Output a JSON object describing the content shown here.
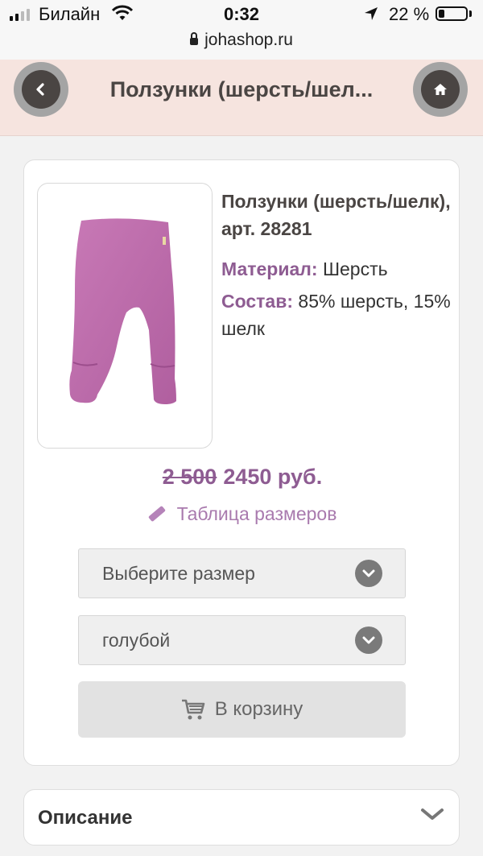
{
  "status_bar": {
    "carrier": "Билайн",
    "time": "0:32",
    "battery": "22 %",
    "battery_level": 0.22,
    "url": "johashop.ru"
  },
  "header": {
    "title": "Ползунки (шерсть/шел...",
    "back_icon": "chevron-left-icon",
    "home_icon": "home-icon"
  },
  "product": {
    "name": "Ползунки (шерсть/шелк), арт. 28281",
    "material_label": "Материал:",
    "material_value": "Шерсть",
    "composition_label": "Состав:",
    "composition_value": "85% шерсть, 15% шелк",
    "old_price": "2 500",
    "price": "2450 руб.",
    "size_table_link": "Таблица размеров",
    "image_color": "#c06aab"
  },
  "options": {
    "size_select": "Выберите размер",
    "color_select": "голубой"
  },
  "cart_button": "В корзину",
  "description": {
    "title": "Описание"
  },
  "colors": {
    "accent": "#8e5c92",
    "header_bg": "#f6e4df",
    "header_text": "#4a4543"
  }
}
